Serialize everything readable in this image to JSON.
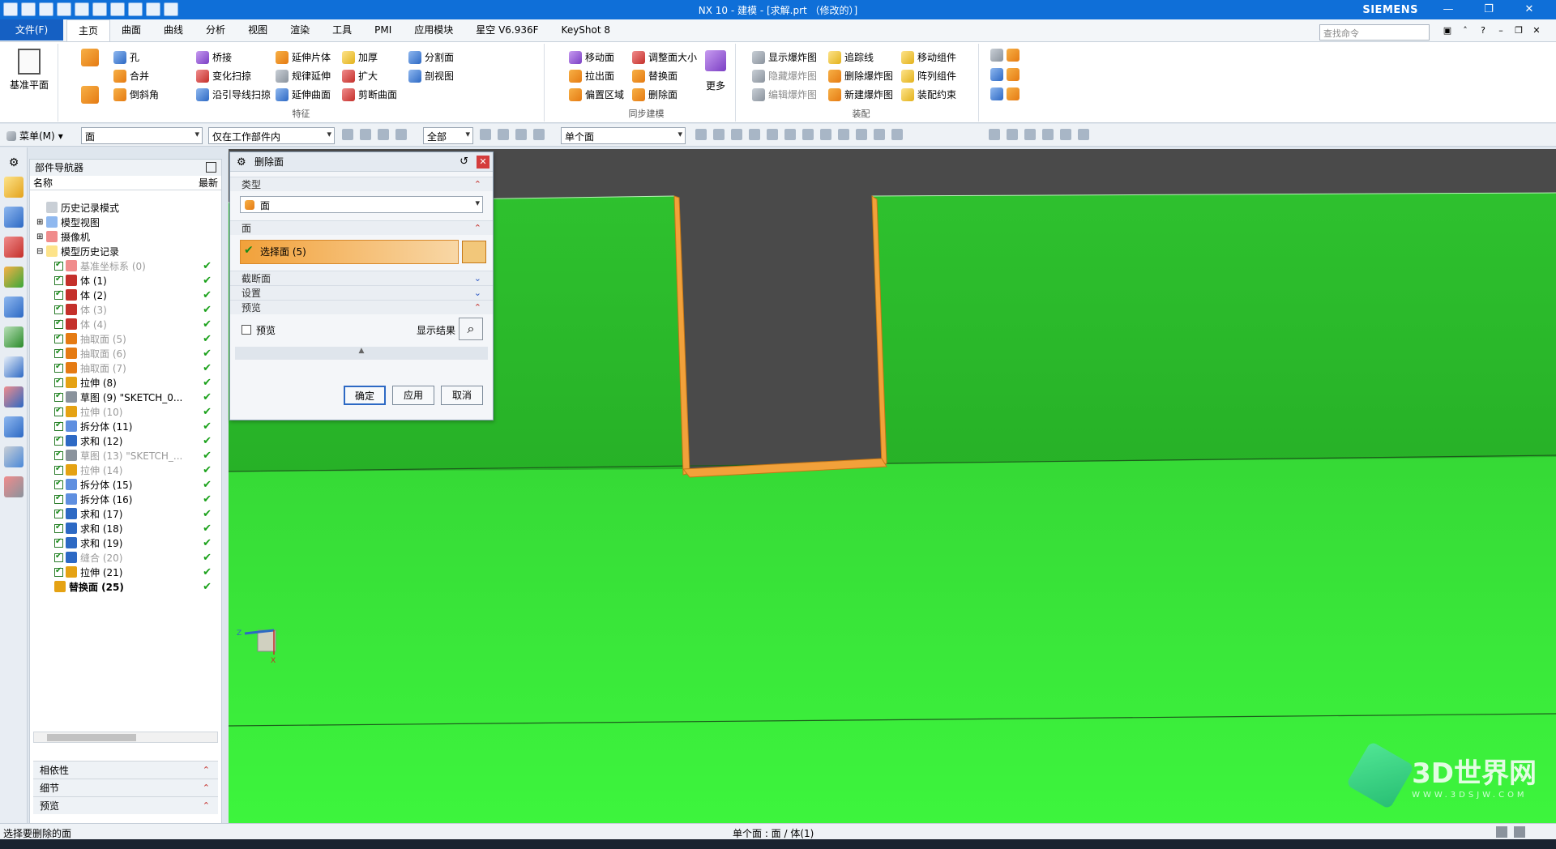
{
  "window": {
    "title": "NX 10 - 建模 - [求解.prt （修改的）]",
    "brand": "SIEMENS"
  },
  "menubar": {
    "file": "文件(F)",
    "tabs": [
      "主页",
      "曲面",
      "曲线",
      "分析",
      "视图",
      "渲染",
      "工具",
      "PMI",
      "应用模块",
      "星空 V6.936F",
      "KeyShot 8"
    ],
    "search_placeholder": "查找命令"
  },
  "ribbon": {
    "datum": "基准平面",
    "feature": {
      "label": "特征",
      "col1": [
        "孔",
        "合并",
        "倒斜角"
      ],
      "col2": [
        "桥接",
        "变化扫掠",
        "沿引导线扫掠"
      ],
      "col3": [
        "延伸片体",
        "规律延伸",
        "延伸曲面"
      ],
      "col4": [
        "加厚",
        "扩大",
        "剪断曲面"
      ],
      "col5": [
        "分割面",
        "剖视图"
      ]
    },
    "sync": {
      "label": "同步建模",
      "col1": [
        "移动面",
        "拉出面",
        "偏置区域"
      ],
      "col2": [
        "调整面大小",
        "替换面",
        "删除面"
      ],
      "more": "更多"
    },
    "assembly": {
      "label": "装配",
      "col1": [
        "显示爆炸图",
        "隐藏爆炸图",
        "编辑爆炸图"
      ],
      "col2": [
        "追踪线",
        "删除爆炸图",
        "新建爆炸图"
      ],
      "col3": [
        "移动组件",
        "阵列组件",
        "装配约束"
      ]
    }
  },
  "toolbar": {
    "menu": "菜单(M)",
    "filter": "面",
    "scope": "仅在工作部件内",
    "all": "全部",
    "rule": "单个面"
  },
  "navigator": {
    "title": "部件导航器",
    "col_name": "名称",
    "col_latest": "最新",
    "items": [
      {
        "label": "历史记录模式",
        "indent": 1,
        "check": false,
        "dim": false,
        "icon": "clock"
      },
      {
        "label": "模型视图",
        "indent": 1,
        "check": false,
        "dim": false,
        "icon": "view"
      },
      {
        "label": "摄像机",
        "indent": 1,
        "check": false,
        "dim": false,
        "icon": "camera"
      },
      {
        "label": "模型历史记录",
        "indent": 1,
        "check": false,
        "dim": false,
        "icon": "folder"
      },
      {
        "label": "基准坐标系 (0)",
        "indent": 2,
        "check": true,
        "dim": true,
        "icon": "datum"
      },
      {
        "label": "体 (1)",
        "indent": 2,
        "check": true,
        "dim": false,
        "icon": "body"
      },
      {
        "label": "体 (2)",
        "indent": 2,
        "check": true,
        "dim": false,
        "icon": "body"
      },
      {
        "label": "体 (3)",
        "indent": 2,
        "check": true,
        "dim": true,
        "icon": "body"
      },
      {
        "label": "体 (4)",
        "indent": 2,
        "check": true,
        "dim": true,
        "icon": "body"
      },
      {
        "label": "抽取面 (5)",
        "indent": 2,
        "check": true,
        "dim": true,
        "icon": "extract"
      },
      {
        "label": "抽取面 (6)",
        "indent": 2,
        "check": true,
        "dim": true,
        "icon": "extract"
      },
      {
        "label": "抽取面 (7)",
        "indent": 2,
        "check": true,
        "dim": true,
        "icon": "extract"
      },
      {
        "label": "拉伸 (8)",
        "indent": 2,
        "check": true,
        "dim": false,
        "icon": "extrude"
      },
      {
        "label": "草图 (9) \"SKETCH_0...",
        "indent": 2,
        "check": true,
        "dim": false,
        "icon": "sketch"
      },
      {
        "label": "拉伸 (10)",
        "indent": 2,
        "check": true,
        "dim": true,
        "icon": "extrude"
      },
      {
        "label": "拆分体 (11)",
        "indent": 2,
        "check": true,
        "dim": false,
        "icon": "split"
      },
      {
        "label": "求和 (12)",
        "indent": 2,
        "check": true,
        "dim": false,
        "icon": "unite"
      },
      {
        "label": "草图 (13) \"SKETCH_...",
        "indent": 2,
        "check": true,
        "dim": true,
        "icon": "sketch"
      },
      {
        "label": "拉伸 (14)",
        "indent": 2,
        "check": true,
        "dim": true,
        "icon": "extrude"
      },
      {
        "label": "拆分体 (15)",
        "indent": 2,
        "check": true,
        "dim": false,
        "icon": "split"
      },
      {
        "label": "拆分体 (16)",
        "indent": 2,
        "check": true,
        "dim": false,
        "icon": "split"
      },
      {
        "label": "求和 (17)",
        "indent": 2,
        "check": true,
        "dim": false,
        "icon": "unite"
      },
      {
        "label": "求和 (18)",
        "indent": 2,
        "check": true,
        "dim": false,
        "icon": "unite"
      },
      {
        "label": "求和 (19)",
        "indent": 2,
        "check": true,
        "dim": false,
        "icon": "unite"
      },
      {
        "label": "缝合 (20)",
        "indent": 2,
        "check": true,
        "dim": true,
        "icon": "sew"
      },
      {
        "label": "拉伸 (21)",
        "indent": 2,
        "check": true,
        "dim": false,
        "icon": "extrude"
      },
      {
        "label": "替换面 (25)",
        "indent": 2,
        "check": false,
        "dim": false,
        "icon": "replace",
        "bold": true
      }
    ],
    "panels": [
      "相依性",
      "细节",
      "预览"
    ]
  },
  "dialog": {
    "title": "删除面",
    "sec_type": "类型",
    "type_value": "面",
    "sec_face": "面",
    "select_face": "选择面 (5)",
    "sec_cut": "截断面",
    "sec_settings": "设置",
    "sec_preview": "预览",
    "preview_cb": "预览",
    "show_result": "显示结果",
    "ok": "确定",
    "apply": "应用",
    "cancel": "取消"
  },
  "status": {
    "left": "选择要删除的面",
    "mid": "单个面 : 面 / 体(1)"
  },
  "watermark": {
    "brand": "3D世界网",
    "url": "WWW.3DSJW.COM"
  },
  "triad": {
    "z": "Z",
    "x": "X"
  },
  "colors": {
    "green": "#3cdc3c",
    "orange": "#f2a13a",
    "gap": "#4a4a4a",
    "accent": "#1560c3"
  }
}
